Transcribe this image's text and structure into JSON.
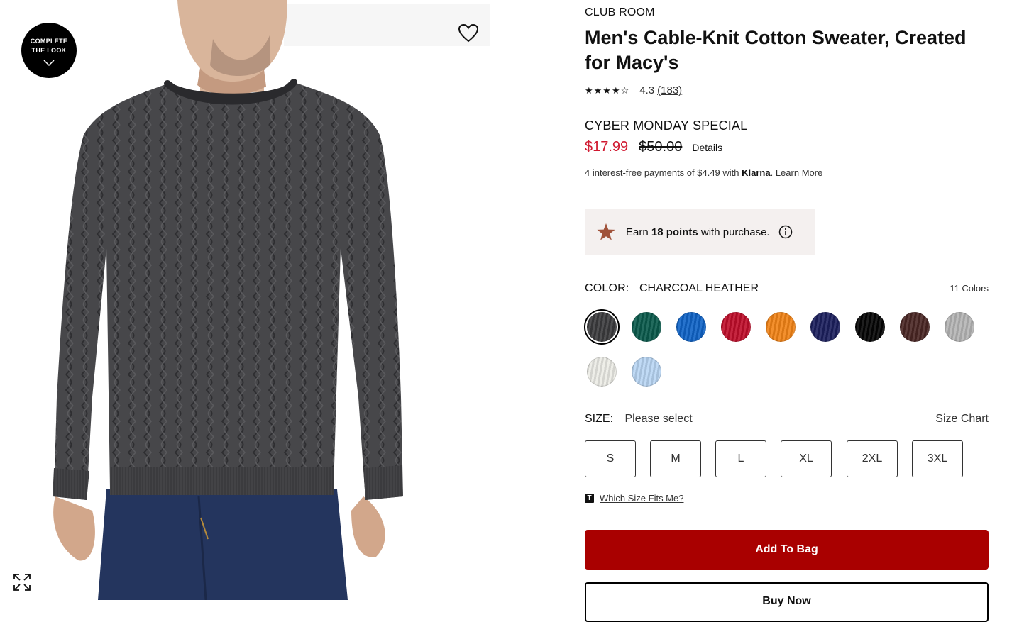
{
  "image": {
    "complete_look_line1": "COMPLETE",
    "complete_look_line2": "THE LOOK",
    "icons": [
      "chevron-down-icon",
      "heart-icon",
      "expand-icon"
    ]
  },
  "product": {
    "brand": "CLUB ROOM",
    "title": "Men's Cable-Knit Cotton Sweater, Created for Macy's",
    "rating_stars": "★★★★☆",
    "rating_value": "4.3",
    "review_count": "(183)",
    "promo_label": "CYBER MONDAY SPECIAL",
    "sale_price": "$17.99",
    "original_price": "$50.00",
    "details_link": "Details",
    "klarna_text": "4 interest-free payments of $4.49 with ",
    "klarna_brand": "Klarna",
    "klarna_dot": ". ",
    "learn_more": "Learn More"
  },
  "rewards": {
    "earn": "Earn ",
    "points": "18 points",
    "suffix": " with purchase."
  },
  "color": {
    "label": "COLOR:",
    "selected": "CHARCOAL HEATHER",
    "count": "11 Colors",
    "swatches": [
      {
        "name": "charcoal",
        "hex": "#3b3b3d"
      },
      {
        "name": "green",
        "hex": "#0a5a4c"
      },
      {
        "name": "blue",
        "hex": "#0f63c7"
      },
      {
        "name": "red",
        "hex": "#c00d2a"
      },
      {
        "name": "orange",
        "hex": "#f28316"
      },
      {
        "name": "navy",
        "hex": "#1c1f5e"
      },
      {
        "name": "black",
        "hex": "#050505"
      },
      {
        "name": "brown",
        "hex": "#4a2624"
      },
      {
        "name": "grey",
        "hex": "#b5b5b5"
      },
      {
        "name": "cream",
        "hex": "#ececE6"
      },
      {
        "name": "light-blue",
        "hex": "#b9d6f4"
      }
    ]
  },
  "size": {
    "label": "SIZE:",
    "value": "Please select",
    "chart_link": "Size Chart",
    "options": [
      "S",
      "M",
      "L",
      "XL",
      "2XL",
      "3XL"
    ],
    "fit_icon": "T",
    "fit_link": "Which Size Fits Me?"
  },
  "actions": {
    "add_to_bag": "Add To Bag",
    "buy_now": "Buy Now"
  }
}
